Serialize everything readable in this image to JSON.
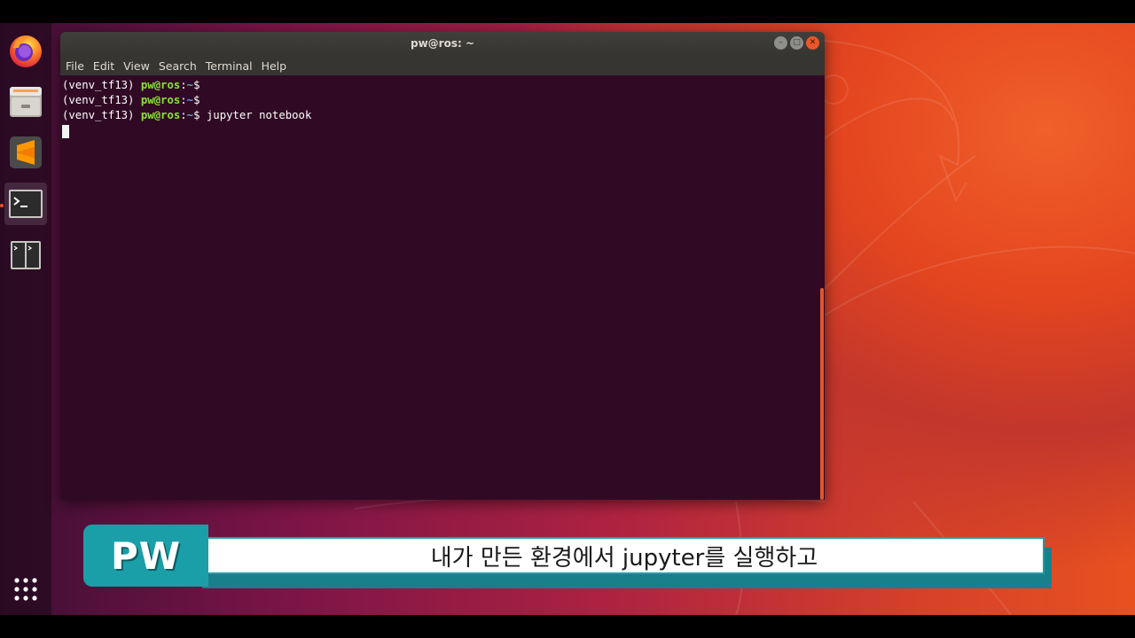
{
  "window": {
    "title": "pw@ros: ~",
    "menu": [
      "File",
      "Edit",
      "View",
      "Search",
      "Terminal",
      "Help"
    ]
  },
  "terminal": {
    "lines": [
      {
        "env": "(venv_tf13) ",
        "user": "pw@ros",
        "sep": ":",
        "path": "~",
        "prompt": "$",
        "command": ""
      },
      {
        "env": "(venv_tf13) ",
        "user": "pw@ros",
        "sep": ":",
        "path": "~",
        "prompt": "$",
        "command": ""
      },
      {
        "env": "(venv_tf13) ",
        "user": "pw@ros",
        "sep": ":",
        "path": "~",
        "prompt": "$",
        "command": " jupyter notebook"
      }
    ]
  },
  "dock": {
    "items": [
      {
        "name": "firefox-icon"
      },
      {
        "name": "files-icon"
      },
      {
        "name": "sublime-text-icon"
      },
      {
        "name": "terminal-icon",
        "active": true
      },
      {
        "name": "terminal-split-icon"
      }
    ],
    "show_apps": "show-applications-icon"
  },
  "caption": {
    "tag": "PW",
    "text": "내가 만든 환경에서 jupyter를 실행하고"
  },
  "colors": {
    "terminal_bg": "#300a24",
    "prompt_user": "#8ae234",
    "prompt_path": "#729fcf",
    "accent": "#e95420",
    "caption_teal": "#1a9fa8"
  }
}
